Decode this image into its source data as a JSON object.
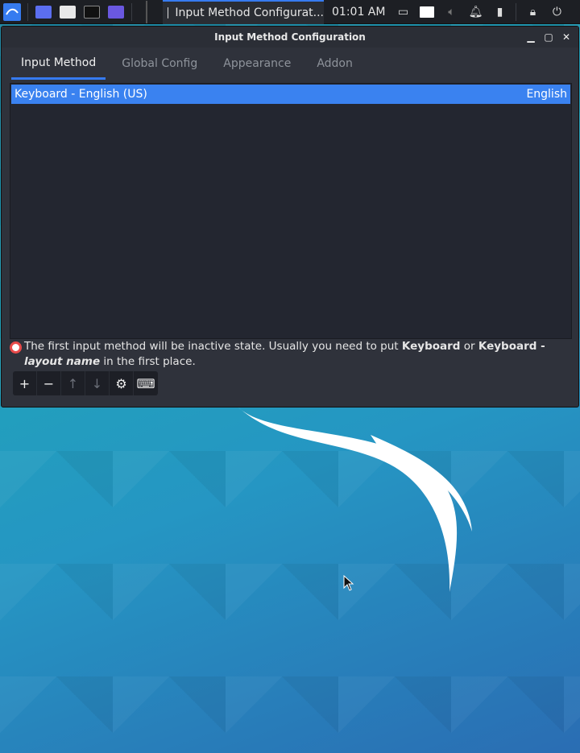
{
  "taskbar": {
    "active_task_title": "Input Method Configurat...",
    "clock": "01:01 AM"
  },
  "window": {
    "title": "Input Method Configuration",
    "tabs": [
      {
        "label": "Input Method"
      },
      {
        "label": "Global Config"
      },
      {
        "label": "Appearance"
      },
      {
        "label": "Addon"
      }
    ],
    "list": [
      {
        "name": "Keyboard - English (US)",
        "language": "English"
      }
    ],
    "notice": {
      "text_1": "The first input method will be inactive state. Usually you need to put ",
      "bold_1": "Keyboard",
      "text_2": " or ",
      "bold_2": "Keyboard - ",
      "italic_1": "layout name",
      "text_3": " in the first place."
    }
  },
  "colors": {
    "accent": "#367bf0",
    "selection": "#3a82f0",
    "window_bg": "#2f323b"
  }
}
